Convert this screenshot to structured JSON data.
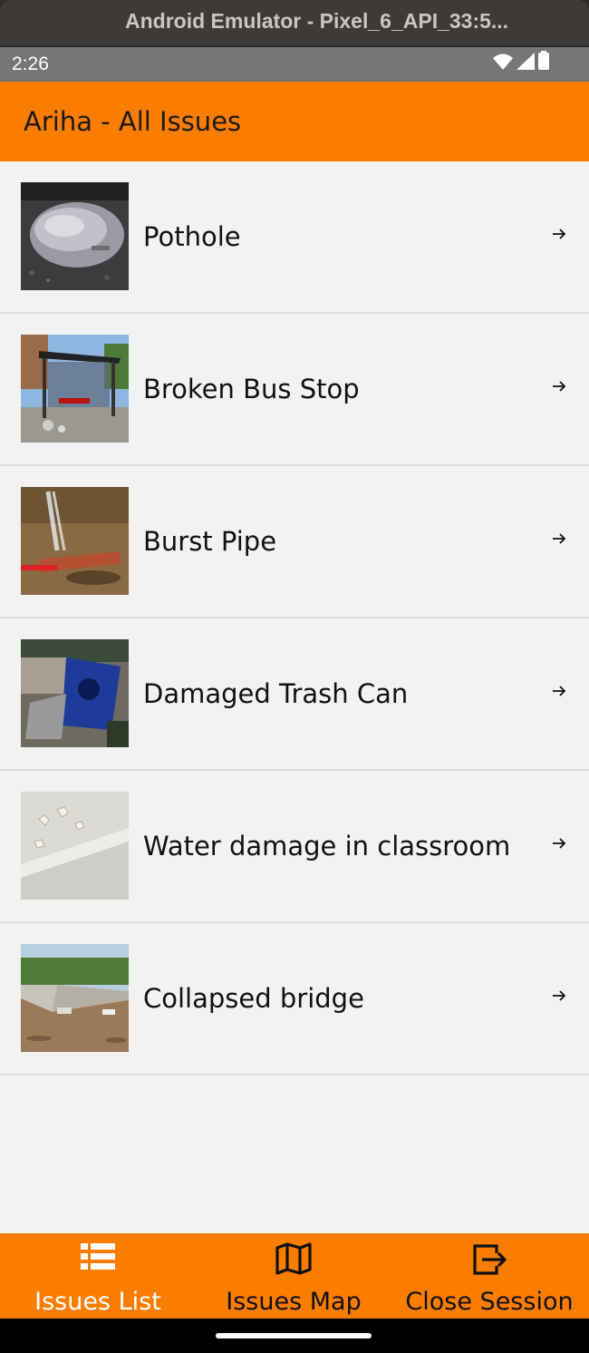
{
  "window": {
    "title": "Android Emulator - Pixel_6_API_33:5..."
  },
  "status_bar": {
    "time": "2:26",
    "icons": [
      "wifi-icon",
      "cell-signal-icon",
      "battery-icon"
    ]
  },
  "app_bar": {
    "title": "Ariha - All Issues",
    "color": "#fb7d00"
  },
  "issues": [
    {
      "title": "Pothole",
      "icon": "pothole-photo",
      "arrow": "arrow-right-icon"
    },
    {
      "title": "Broken Bus Stop",
      "icon": "bus-stop-photo",
      "arrow": "arrow-right-icon"
    },
    {
      "title": "Burst Pipe",
      "icon": "burst-pipe-photo",
      "arrow": "arrow-right-icon"
    },
    {
      "title": "Damaged Trash Can",
      "icon": "trash-can-photo",
      "arrow": "arrow-right-icon"
    },
    {
      "title": "Water damage in classroom",
      "icon": "water-damage-photo",
      "arrow": "arrow-right-icon"
    },
    {
      "title": "Collapsed bridge",
      "icon": "bridge-photo",
      "arrow": "arrow-right-icon"
    }
  ],
  "bottom_nav": {
    "items": [
      {
        "label": "Issues List",
        "icon": "list-icon",
        "active": true
      },
      {
        "label": "Issues Map",
        "icon": "map-icon",
        "active": false
      },
      {
        "label": "Close Session",
        "icon": "exit-icon",
        "active": false
      }
    ],
    "active_color": "#ffffff",
    "inactive_color": "#111111"
  }
}
